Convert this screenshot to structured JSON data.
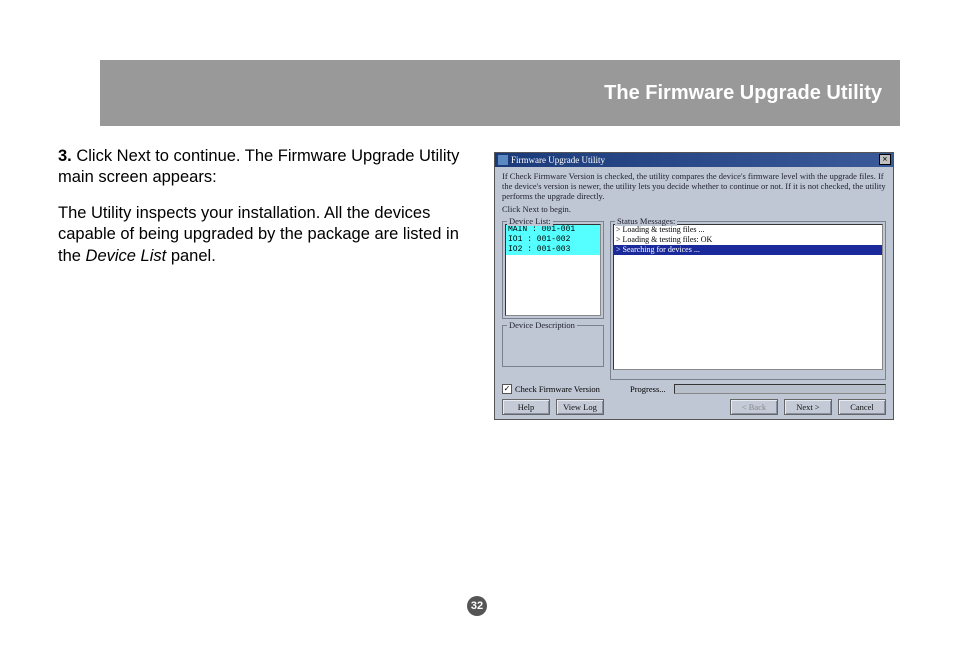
{
  "header": {
    "title": "The Firmware Upgrade Utility"
  },
  "doc": {
    "step_num": "3.",
    "para1_a": " Click Next to continue. The Firmware Upgrade Utility main screen appears:",
    "para2_a": "The Utility inspects your installation. All the devices capable of being upgraded by the package are listed in the ",
    "para2_emph": "Device List",
    "para2_b": " panel."
  },
  "page_number": "32",
  "app": {
    "title": "Firmware Upgrade Utility",
    "close_glyph": "×",
    "instruction_line1": "If Check Firmware Version is checked, the utility compares the device's firmware level with the upgrade files. If the device's version is newer, the utility lets you decide whether to continue or not. If it is not checked, the utility performs the upgrade directly.",
    "instruction_line2": "Click Next to begin.",
    "device_list_label": "Device List:",
    "status_label": "Status Messages:",
    "device_items": [
      "MAIN : 001-001",
      "IO1 : 001-002",
      "IO2 : 001-003"
    ],
    "status_items": [
      {
        "text": "> Loading & testing files ...",
        "hl": false
      },
      {
        "text": "> Loading & testing files: OK",
        "hl": false
      },
      {
        "text": "> Searching for devices ...",
        "hl": true
      }
    ],
    "desc_label": "Device Description",
    "checkbox_label": "Check Firmware Version",
    "checkbox_mark": "✓",
    "progress_label": "Progress...",
    "buttons": {
      "help": "Help",
      "viewlog": "View Log",
      "back": "< Back",
      "next": "Next >",
      "cancel": "Cancel"
    }
  }
}
